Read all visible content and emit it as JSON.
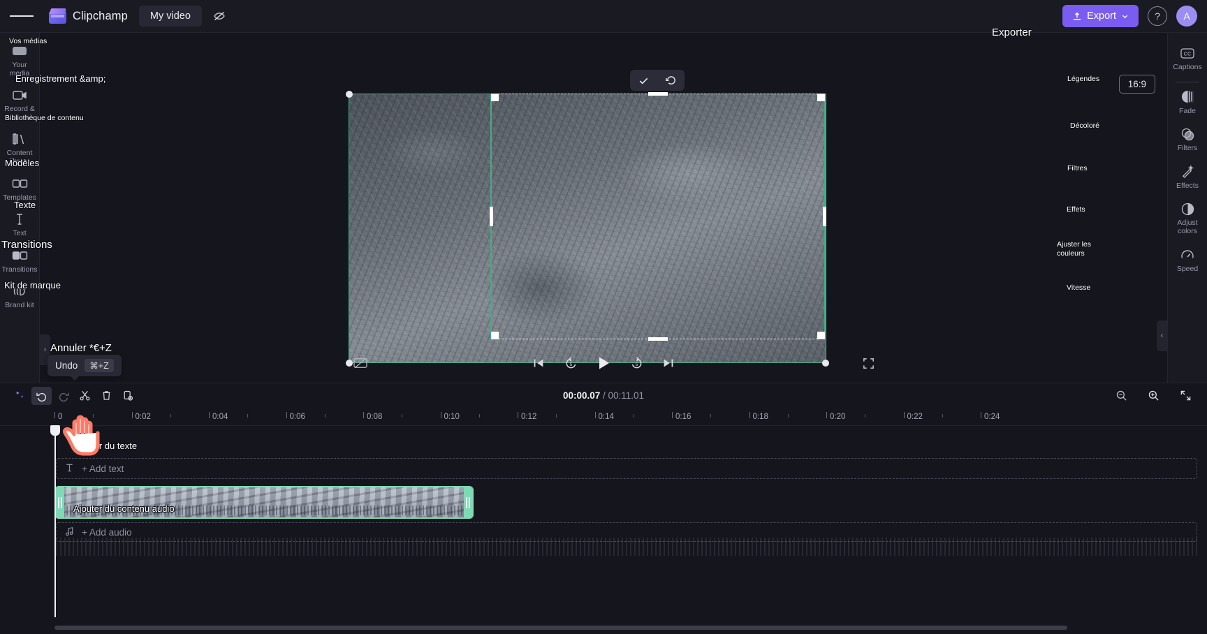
{
  "app": {
    "brand_name": "Clipchamp",
    "project_title": "My video",
    "export_label": "Export",
    "help_label": "?",
    "avatar_initial": "A"
  },
  "left_rail": {
    "items": [
      {
        "label": "Your media",
        "icon": "media-icon",
        "fr": "Vos médias"
      },
      {
        "label": "Record & create",
        "icon": "record-icon",
        "fr": "Enregistrement &amp;"
      },
      {
        "label": "Content library",
        "icon": "library-icon",
        "fr": "Bibliothèque de contenu"
      },
      {
        "label": "Templates",
        "icon": "templates-icon",
        "fr": "Modèles"
      },
      {
        "label": "Text",
        "icon": "text-icon",
        "fr": "Texte"
      },
      {
        "label": "Transitions",
        "icon": "transitions-icon",
        "fr": "Transitions"
      },
      {
        "label": "Brand kit",
        "icon": "brandkit-icon",
        "fr": "Kit de marque"
      }
    ],
    "expand_icon": "chevron-right-icon"
  },
  "right_rail": {
    "ratio_chip": "16:9",
    "export_fr": "Exporter",
    "items": [
      {
        "label": "Captions",
        "icon": "captions-icon",
        "fr": "Légendes"
      },
      {
        "label": "Fade",
        "icon": "fade-icon",
        "fr": "Décoloré"
      },
      {
        "label": "Filters",
        "icon": "filters-icon",
        "fr": "Filtres"
      },
      {
        "label": "Effects",
        "icon": "effects-icon",
        "fr": "Effets"
      },
      {
        "label": "Adjust colors",
        "icon": "adjust-colors-icon",
        "fr": "Ajuster les couleurs"
      },
      {
        "label": "Speed",
        "icon": "speed-icon",
        "fr": "Vitesse"
      }
    ],
    "collapse_icon": "chevron-left-icon"
  },
  "crop_toolbar": {
    "confirm_icon": "check-icon",
    "reset_icon": "undo-arrow-icon"
  },
  "player": {
    "captions_toggle_icon": "captions-off-icon",
    "prev_icon": "skip-back-icon",
    "back5_icon": "rewind-5-icon",
    "play_icon": "play-icon",
    "fwd5_icon": "forward-5-icon",
    "next_icon": "skip-forward-icon",
    "fullscreen_icon": "fullscreen-icon"
  },
  "timeline": {
    "tools": [
      {
        "name": "magic-wand-icon",
        "state": "normal"
      },
      {
        "name": "undo-icon",
        "state": "active"
      },
      {
        "name": "redo-icon",
        "state": "dim"
      },
      {
        "name": "split-icon",
        "state": "normal"
      },
      {
        "name": "delete-icon",
        "state": "normal"
      },
      {
        "name": "duplicate-icon",
        "state": "normal"
      }
    ],
    "current_time": "00:00.07",
    "time_separator": " / ",
    "total_time": "00:11.01",
    "zoom_out_icon": "zoom-out-icon",
    "zoom_in_icon": "zoom-in-icon",
    "fit_icon": "fit-timeline-icon",
    "ruler_labels": [
      "0",
      "0:02",
      "0:04",
      "0:06",
      "0:08",
      "0:10",
      "0:12",
      "0:14",
      "0:16",
      "0:18",
      "0:20",
      "0:22",
      "0:24"
    ],
    "add_text_label": "+ Add text",
    "add_text_icon": "text-t-icon",
    "add_audio_label": "+ Add audio",
    "add_audio_icon": "music-note-icon"
  },
  "tooltips": {
    "undo": {
      "label": "Undo",
      "shortcut": "⌘+Z",
      "fr": "Annuler *€+Z"
    }
  },
  "overlays": {
    "add_text_fr": "Ajouter du texte",
    "add_audio_fr": "Ajouter du contenu audio"
  },
  "colors": {
    "accent": "#7b5cf0",
    "selection_green": "#7fd9b5",
    "cursor_red": "#ff7a66",
    "panel_bg": "#191a22",
    "app_bg": "#15161d"
  }
}
